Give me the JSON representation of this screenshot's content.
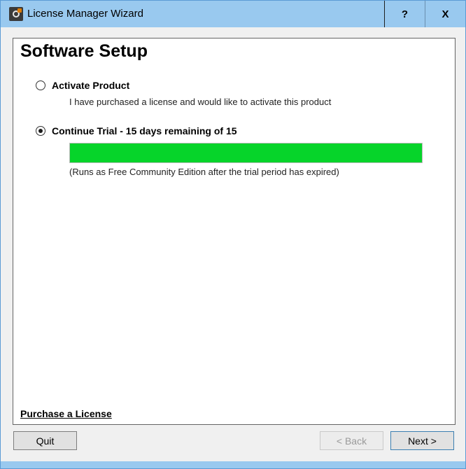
{
  "window": {
    "title": "License Manager Wizard",
    "help_label": "?",
    "close_label": "X"
  },
  "page": {
    "heading": "Software Setup"
  },
  "options": [
    {
      "label": "Activate Product",
      "description": "I have purchased a license and would like to activate this product",
      "selected": false
    },
    {
      "label": "Continue Trial - 15 days remaining of 15",
      "description": "(Runs as Free Community Edition after the trial period has expired)",
      "selected": true
    }
  ],
  "trial": {
    "days_remaining": 15,
    "days_total": 15,
    "progress_fraction": 1.0,
    "bar_color": "#06d42a"
  },
  "links": {
    "purchase": "Purchase a License"
  },
  "buttons": {
    "quit": "Quit",
    "back": "< Back",
    "next": "Next >"
  },
  "colors": {
    "titlebar": "#99c9ef",
    "progress_green": "#06d42a"
  }
}
